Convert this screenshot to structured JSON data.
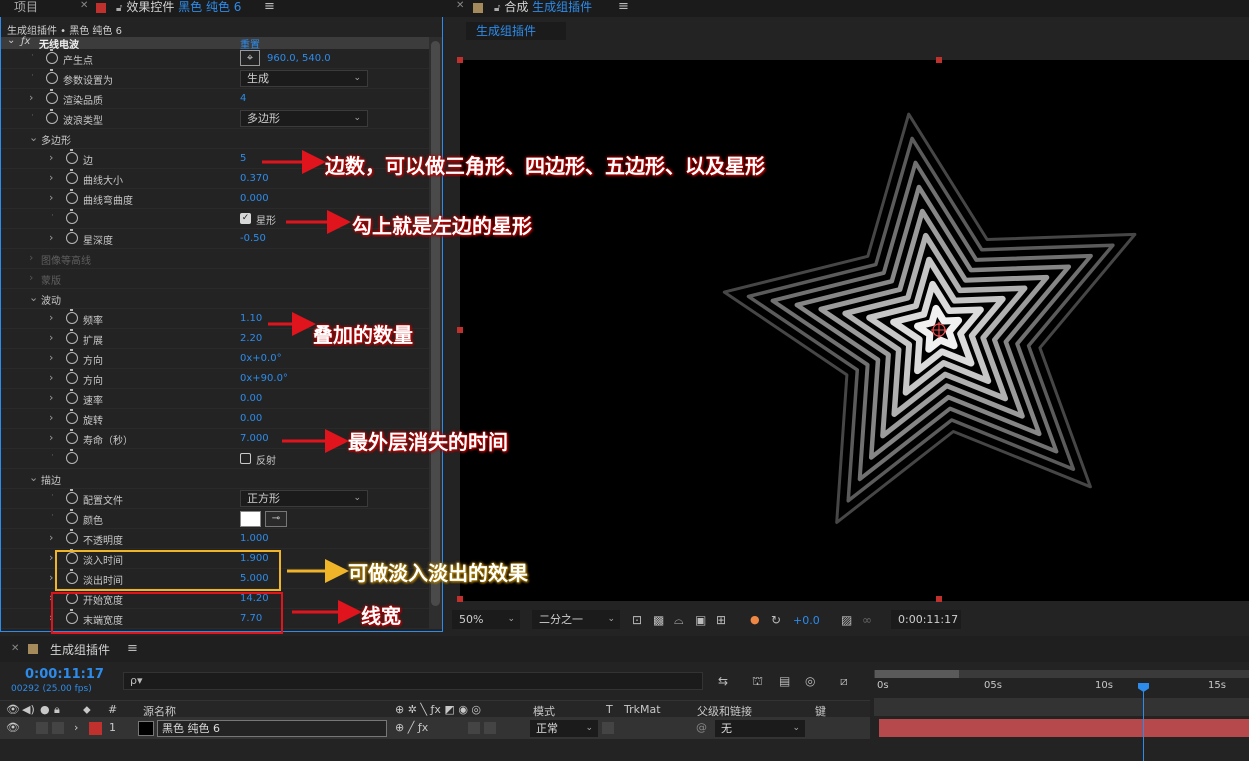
{
  "tabs": {
    "project": "项目",
    "effect_controls_prefix": "效果控件",
    "effect_controls_layer": "黑色 纯色 6",
    "comp_prefix": "合成",
    "comp_name": "生成组插件"
  },
  "effect_controls": {
    "breadcrumb": "生成组插件 • 黑色 纯色 6",
    "effect_name": "无线电波",
    "effect_reset": "重置",
    "rows": {
      "producer_point": {
        "label": "产生点",
        "value": "960.0, 540.0"
      },
      "param_setting": {
        "label": "参数设置为",
        "value": "生成"
      },
      "render_quality": {
        "label": "渲染品质",
        "value": "4"
      },
      "wave_type": {
        "label": "波浪类型",
        "value": "多边形"
      },
      "polygon": {
        "label": "多边形"
      },
      "sides": {
        "label": "边",
        "value": "5"
      },
      "curve_size": {
        "label": "曲线大小",
        "value": "0.370"
      },
      "curvature": {
        "label": "曲线弯曲度",
        "value": "0.000"
      },
      "star": {
        "label": "星形"
      },
      "star_depth": {
        "label": "星深度",
        "value": "-0.50"
      },
      "image_contour": {
        "label": "图像等高线"
      },
      "mask": {
        "label": "蒙版"
      },
      "wave_motion": {
        "label": "波动"
      },
      "frequency": {
        "label": "频率",
        "value": "1.10"
      },
      "expansion": {
        "label": "扩展",
        "value": "2.20"
      },
      "orientation": {
        "label": "方向",
        "value_prefix": "0x",
        "value": "+0.0°"
      },
      "direction": {
        "label": "方向",
        "value_prefix": "0x",
        "value": "+90.0°"
      },
      "velocity": {
        "label": "速率",
        "value": "0.00"
      },
      "spin": {
        "label": "旋转",
        "value": "0.00"
      },
      "lifespan": {
        "label": "寿命（秒）",
        "value": "7.000"
      },
      "reflection": {
        "label": "反射"
      },
      "stroke": {
        "label": "描边"
      },
      "profile": {
        "label": "配置文件",
        "value": "正方形"
      },
      "color": {
        "label": "颜色"
      },
      "opacity": {
        "label": "不透明度",
        "value": "1.000"
      },
      "fade_in": {
        "label": "淡入时间",
        "value": "1.900"
      },
      "fade_out": {
        "label": "淡出时间",
        "value": "5.000"
      },
      "start_width": {
        "label": "开始宽度",
        "value": "14.20"
      },
      "end_width": {
        "label": "末端宽度",
        "value": "7.70"
      }
    }
  },
  "annotations": {
    "sides_note": "边数，可以做三角形、四边形、五边形、以及星形",
    "star_note": "勾上就是左边的星形",
    "frequency_note": "叠加的数量",
    "lifespan_note": "最外层消失的时间",
    "fade_note": "可做淡入淡出的效果",
    "width_note": "线宽"
  },
  "composition": {
    "tab_label": "生成组插件",
    "zoom": "50%",
    "resolution": "二分之一",
    "exposure": "+0.0",
    "timecode": "0:00:11:17"
  },
  "timeline": {
    "comp_name": "生成组插件",
    "current_time": "0:00:11:17",
    "frames": "00292 (25.00 fps)",
    "search_placeholder": "ρ▾",
    "headers": {
      "number": "#",
      "source_name": "源名称",
      "mode": "模式",
      "t": "T",
      "trkmat": "TrkMat",
      "parent": "父级和链接",
      "keys": "键"
    },
    "layer": {
      "number": "1",
      "name": "黑色 纯色 6",
      "mode": "正常",
      "parent": "无"
    },
    "ruler_ticks": [
      "0s",
      "05s",
      "10s",
      "15s"
    ]
  },
  "colors": {
    "accent": "#2d8ceb",
    "annotation_red": "#e0141c",
    "annotation_yellow": "#f0b429",
    "layer_bar": "#b5494c"
  }
}
